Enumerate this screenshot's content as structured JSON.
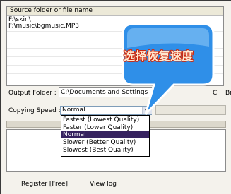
{
  "file_list": {
    "header": "Source folder or file name",
    "rows": [
      "F:\\skin\\",
      "F:\\music\\bgmusic.MP3"
    ]
  },
  "output_folder": {
    "label": "Output Folder :",
    "value": "C:\\Documents and Settings",
    "trailing_1": "C",
    "trailing_2": "Br"
  },
  "copying_speed": {
    "label": "Copying Speed :",
    "selected": "Normal",
    "options": [
      "Fastest (Lowest Quality)",
      "Faster (Lower Quality)",
      "Normal",
      "Slower (Better Quality)",
      "Slowest (Best Quality)"
    ],
    "selected_index": 2
  },
  "bottom": {
    "register": "Register [Free]",
    "view_log": "View log"
  },
  "callout": {
    "text": "选择恢复速度"
  },
  "colors": {
    "callout_fill": "#2f8fe8",
    "callout_stroke": "#ffffff",
    "selected_option": "#36225f"
  }
}
